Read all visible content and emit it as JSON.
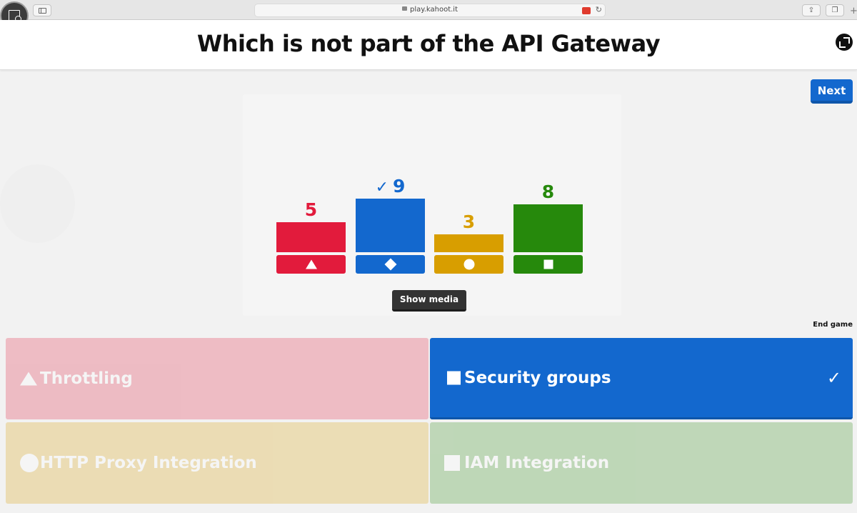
{
  "browser": {
    "url": "play.kahoot.it"
  },
  "question": {
    "title": "Which is not part of the API Gateway"
  },
  "controls": {
    "next_label": "Next",
    "show_media_label": "Show media",
    "end_game_label": "End game"
  },
  "colors": {
    "red": "#e21b3c",
    "blue": "#1368ce",
    "yellow": "#d89e00",
    "green": "#26890c"
  },
  "chart_data": {
    "type": "bar",
    "categories": [
      "triangle",
      "diamond",
      "circle",
      "square"
    ],
    "values": [
      5,
      9,
      3,
      8
    ],
    "correct": [
      false,
      true,
      false,
      false
    ]
  },
  "answers": [
    {
      "shape": "triangle-icon",
      "label": "Throttling",
      "correct": false
    },
    {
      "shape": "diamond-icon",
      "label": "Security groups",
      "correct": true
    },
    {
      "shape": "circle-icon",
      "label": "HTTP Proxy Integration",
      "correct": false
    },
    {
      "shape": "square-icon",
      "label": "IAM Integration",
      "correct": false
    }
  ]
}
